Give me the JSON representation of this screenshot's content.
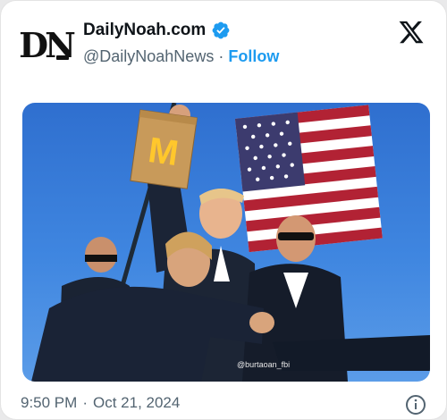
{
  "tweet": {
    "avatar_alt": "DN",
    "display_name": "DailyNoah.com",
    "handle": "@DailyNoahNews",
    "separator": "·",
    "follow_label": "Follow",
    "time": "9:50 PM",
    "date": "Oct 21, 2024",
    "verified": true
  },
  "photo": {
    "watermark": "@burtaoan_fbi",
    "bag_logo": "M"
  },
  "colors": {
    "link": "#1d9bf0",
    "muted": "#536471",
    "verified": "#1d9bf0",
    "sky": "#3f86e0",
    "bag": "#c89a5a",
    "mcd_yellow": "#ffc72c",
    "mcd_red": "#da291c"
  },
  "icons": [
    "x-logo-icon",
    "verified-badge-icon",
    "info-icon"
  ]
}
